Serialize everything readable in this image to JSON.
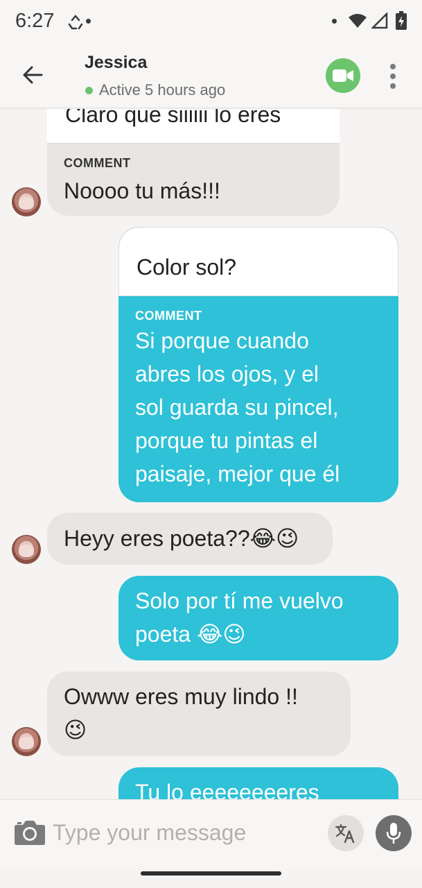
{
  "status_bar": {
    "time": "6:27",
    "icons": [
      "recycle-icon",
      "notification-dot",
      "wifi-icon",
      "signal-icon",
      "battery-charging-icon"
    ]
  },
  "header": {
    "contact_name": "Jessica",
    "status_text": "Active 5 hours ago",
    "status_color": "#6dc36d",
    "video_button_color": "#6cc46c"
  },
  "messages": [
    {
      "direction": "incoming",
      "quoted_text": "Claro que siiiiii lo eres",
      "comment_label": "COMMENT",
      "text": "Noooo tu más!!!"
    },
    {
      "direction": "outgoing",
      "quoted_text": "Color sol?",
      "comment_label": "COMMENT",
      "lines": [
        "Si porque cuando",
        "abres los ojos, y el",
        "sol guarda su pincel,",
        "porque tu pintas el",
        "paisaje, mejor que él"
      ]
    },
    {
      "direction": "incoming",
      "text": "Heyy eres poeta??😂😉"
    },
    {
      "direction": "outgoing",
      "lines": [
        "Solo por tí me vuelvo",
        "poeta 😂😉"
      ]
    },
    {
      "direction": "incoming",
      "lines": [
        "Owww eres muy lindo !!",
        "😉"
      ]
    },
    {
      "direction": "outgoing",
      "text": "Tu lo eeeeeeeeres"
    }
  ],
  "composer": {
    "placeholder": "Type your message"
  },
  "colors": {
    "outgoing_bubble": "#2ec1d7",
    "incoming_bubble": "#e8e5e3",
    "background": "#f6f4f3"
  }
}
